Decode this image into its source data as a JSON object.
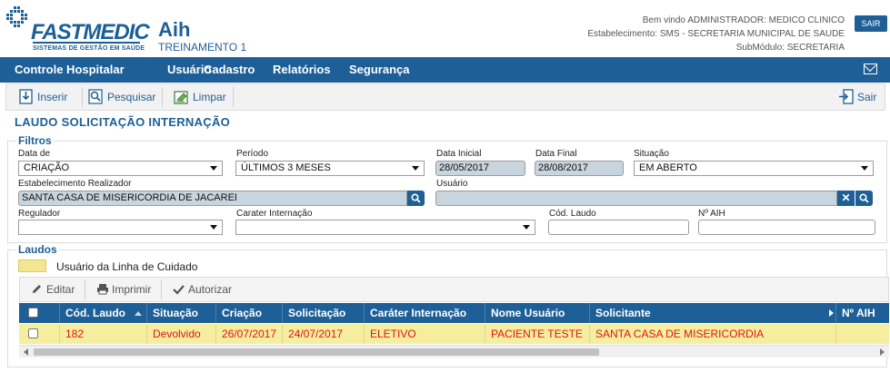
{
  "header": {
    "logo_text": "FASTMEDIC",
    "logo_subtitle": "SISTEMAS DE GESTÃO EM SAÚDE",
    "app_title": "Aih",
    "app_subtitle": "TREINAMENTO 1",
    "welcome": "Bem vindo ADMINISTRADOR: MEDICO CLINICO",
    "establishment": "Estabelecimento: SMS - SECRETARIA MUNICIPAL DE SAUDE",
    "submodule": "SubMódulo: SECRETARIA",
    "logout_label": "SAIR"
  },
  "nav": {
    "items": [
      "Controle Hospitalar",
      "Usuário",
      "Cadastro",
      "Relatórios",
      "Segurança"
    ]
  },
  "toolbar": {
    "insert_label": "Inserir",
    "search_label": "Pesquisar",
    "clear_label": "Limpar",
    "exit_label": "Sair"
  },
  "page": {
    "title": "LAUDO SOLICITAÇÃO INTERNAÇÃO"
  },
  "filters": {
    "legend": "Filtros",
    "data_de_label": "Data de",
    "data_de_value": "CRIAÇÃO",
    "periodo_label": "Período",
    "periodo_value": "ÚLTIMOS 3 MESES",
    "data_inicial_label": "Data Inicial",
    "data_inicial_value": "28/05/2017",
    "data_final_label": "Data Final",
    "data_final_value": "28/08/2017",
    "situacao_label": "Situação",
    "situacao_value": "EM ABERTO",
    "estab_label": "Estabelecimento Realizador",
    "estab_value": "SANTA CASA DE MISERICORDIA DE JACAREI",
    "usuario_label": "Usuário",
    "usuario_value": "",
    "regulador_label": "Regulador",
    "regulador_value": "",
    "carater_label": "Carater Internação",
    "carater_value": "",
    "cod_laudo_label": "Cód. Laudo",
    "cod_laudo_value": "",
    "n_aih_label": "Nº AIH",
    "n_aih_value": ""
  },
  "laudos": {
    "legend": "Laudos",
    "legend_item": "Usuário da Linha de Cuidado",
    "legend_color": "#f3e68f",
    "edit_label": "Editar",
    "print_label": "Imprimir",
    "authorize_label": "Autorizar",
    "columns": [
      "Cód. Laudo",
      "Situação",
      "Criação",
      "Solicitação",
      "Caráter Internação",
      "Nome Usuário",
      "Solicitante",
      "Nº AIH"
    ],
    "rows": [
      [
        "182",
        "Devolvido",
        "26/07/2017",
        "24/07/2017",
        "ELETIVO",
        "PACIENTE TESTE",
        "SANTA CASA DE MISERICORDIA",
        ""
      ]
    ]
  },
  "colors": {
    "brand": "#1d5f96",
    "row_highlight": "#f6ee9f",
    "row_text": "#e0131a"
  }
}
